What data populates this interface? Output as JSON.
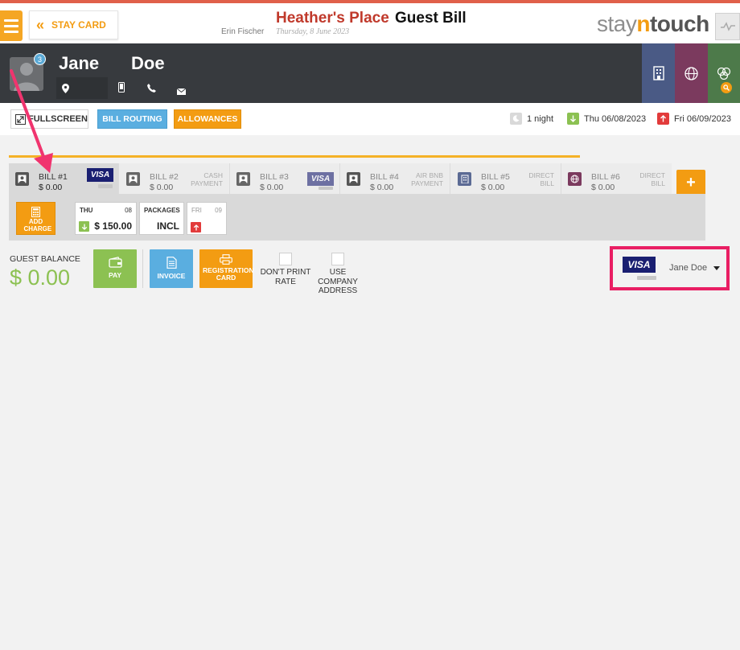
{
  "header": {
    "stay_card_label": "STAY CARD",
    "hotel_name": "Heather's Place",
    "page_title": "Guest Bill",
    "user_name": "Erin Fischer",
    "date": "Thursday, 8 June 2023",
    "logo": {
      "part1": "stay",
      "part2": "n",
      "part3": "touch"
    }
  },
  "guest": {
    "first_name": "Jane",
    "last_name": "Doe",
    "badge_count": "3"
  },
  "toolbar": {
    "fullscreen_label": "FULLSCREEN",
    "bill_routing_label": "BILL ROUTING",
    "allowances_label": "ALLOWANCES",
    "nights": "1 night",
    "arrival": "Thu 06/08/2023",
    "departure": "Fri 06/09/2023"
  },
  "bills": [
    {
      "name": "BILL #1",
      "amount": "$ 0.00",
      "payment": "VISA",
      "payment_type": "visa"
    },
    {
      "name": "BILL #2",
      "amount": "$ 0.00",
      "payment": "CASH PAYMENT",
      "payment_type": "text"
    },
    {
      "name": "BILL #3",
      "amount": "$ 0.00",
      "payment": "VISA",
      "payment_type": "visa"
    },
    {
      "name": "BILL #4",
      "amount": "$ 0.00",
      "payment": "AIR BNB PAYMENT",
      "payment_type": "text"
    },
    {
      "name": "BILL #5",
      "amount": "$ 0.00",
      "payment": "DIRECT BILL",
      "payment_type": "text"
    },
    {
      "name": "BILL #6",
      "amount": "$ 0.00",
      "payment": "DIRECT BILL",
      "payment_type": "text"
    }
  ],
  "add_bill_label": "+",
  "charges": {
    "add_charge_label": "ADD CHARGE",
    "day1": {
      "label": "THU",
      "num": "08",
      "value": "$ 150.00"
    },
    "packages": {
      "label": "PACKAGES",
      "value": "INCL"
    },
    "day2": {
      "label": "FRI",
      "num": "09"
    }
  },
  "balance": {
    "label": "GUEST BALANCE",
    "amount": "$ 0.00"
  },
  "actions": {
    "pay": "PAY",
    "invoice": "INVOICE",
    "registration_card": "REGISTRATION CARD",
    "dont_print_rate": "DON'T PRINT RATE",
    "use_company_address": "USE COMPANY ADDRESS"
  },
  "payment_method": {
    "card": "VISA",
    "holder": "Jane Doe"
  },
  "colors": {
    "accent_orange": "#f39c12",
    "brand_red": "#c0392b",
    "green": "#8cc152",
    "blue": "#5aaee0",
    "highlight_pink": "#e91e63"
  }
}
